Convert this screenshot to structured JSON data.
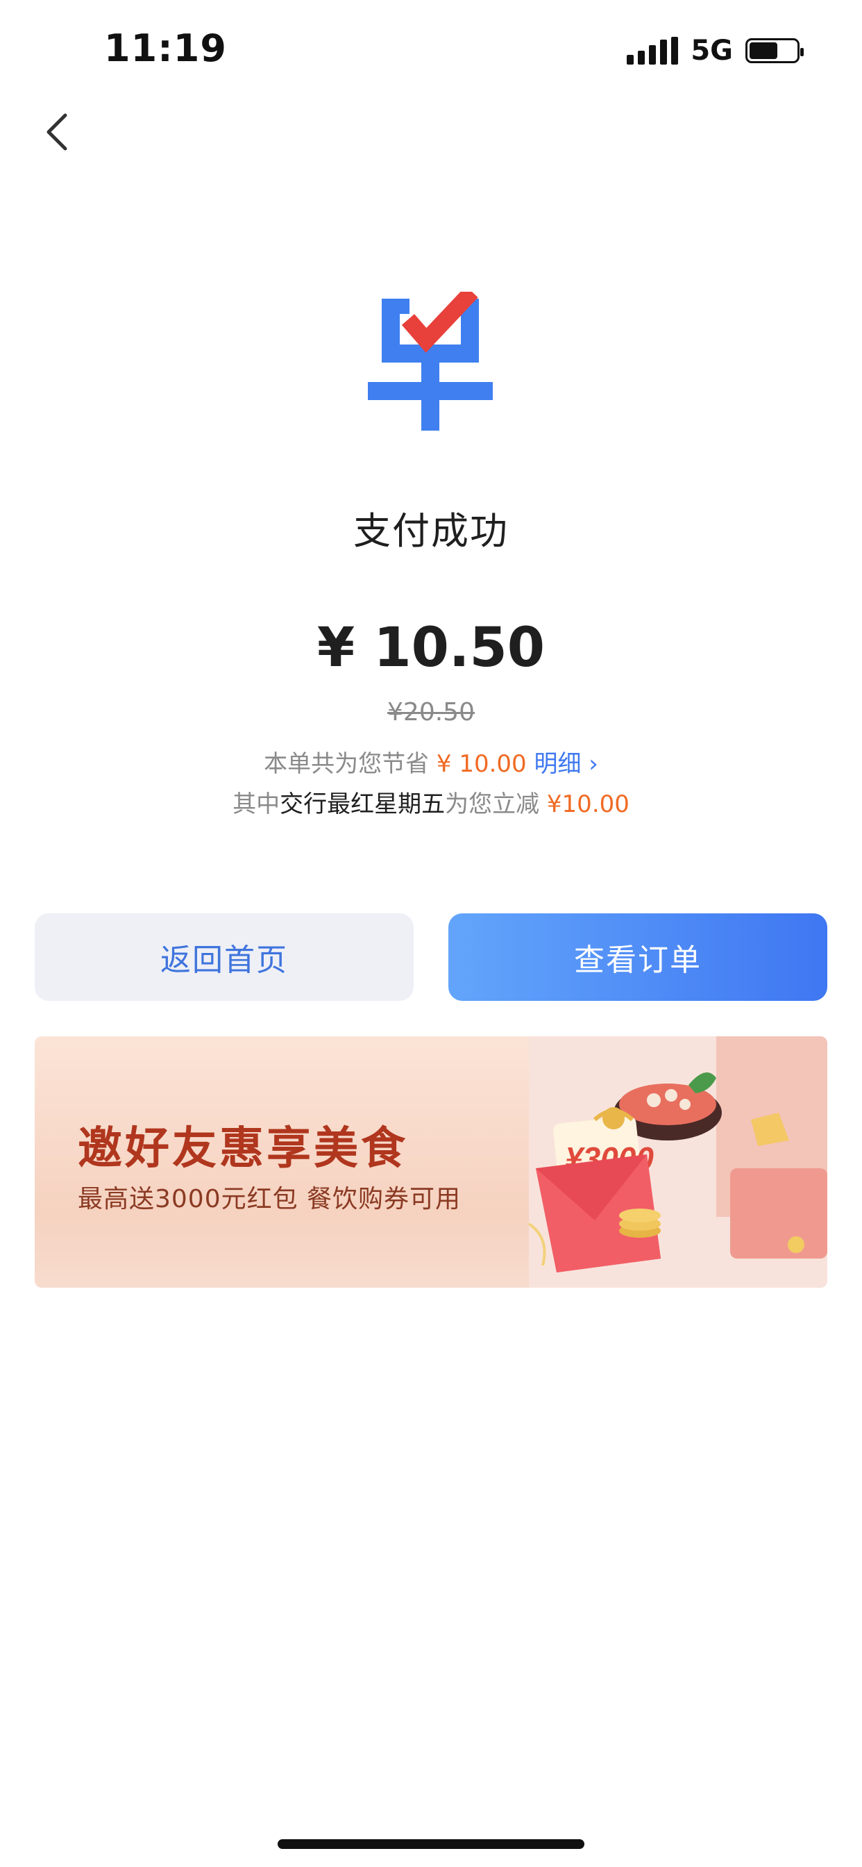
{
  "status_bar": {
    "time": "11:19",
    "network": "5G",
    "battery_level": 0.6
  },
  "result": {
    "title": "支付成功",
    "amount": "¥ 10.50",
    "original_price": "¥20.50",
    "savings_prefix": "本单共为您节省",
    "savings_amount": "¥ 10.00",
    "details_link": "明细",
    "promo_prefix": "其中",
    "promo_name": "交行最红星期五",
    "promo_middle": "为您立减",
    "promo_amount": "¥10.00"
  },
  "actions": {
    "home_label": "返回首页",
    "order_label": "查看订单"
  },
  "banner": {
    "title": "邀好友惠享美食",
    "subtitle": "最高送3000元红包 餐饮购券可用",
    "envelope_amount": "¥3000"
  },
  "colors": {
    "accent_blue": "#3f78f0",
    "accent_orange": "#f06a23",
    "logo_blue": "#3f7ff0",
    "logo_red": "#e8403a"
  },
  "icons": {
    "back": "chevron-left-icon",
    "logo": "order-check-logo",
    "details": "chevron-right-icon"
  }
}
